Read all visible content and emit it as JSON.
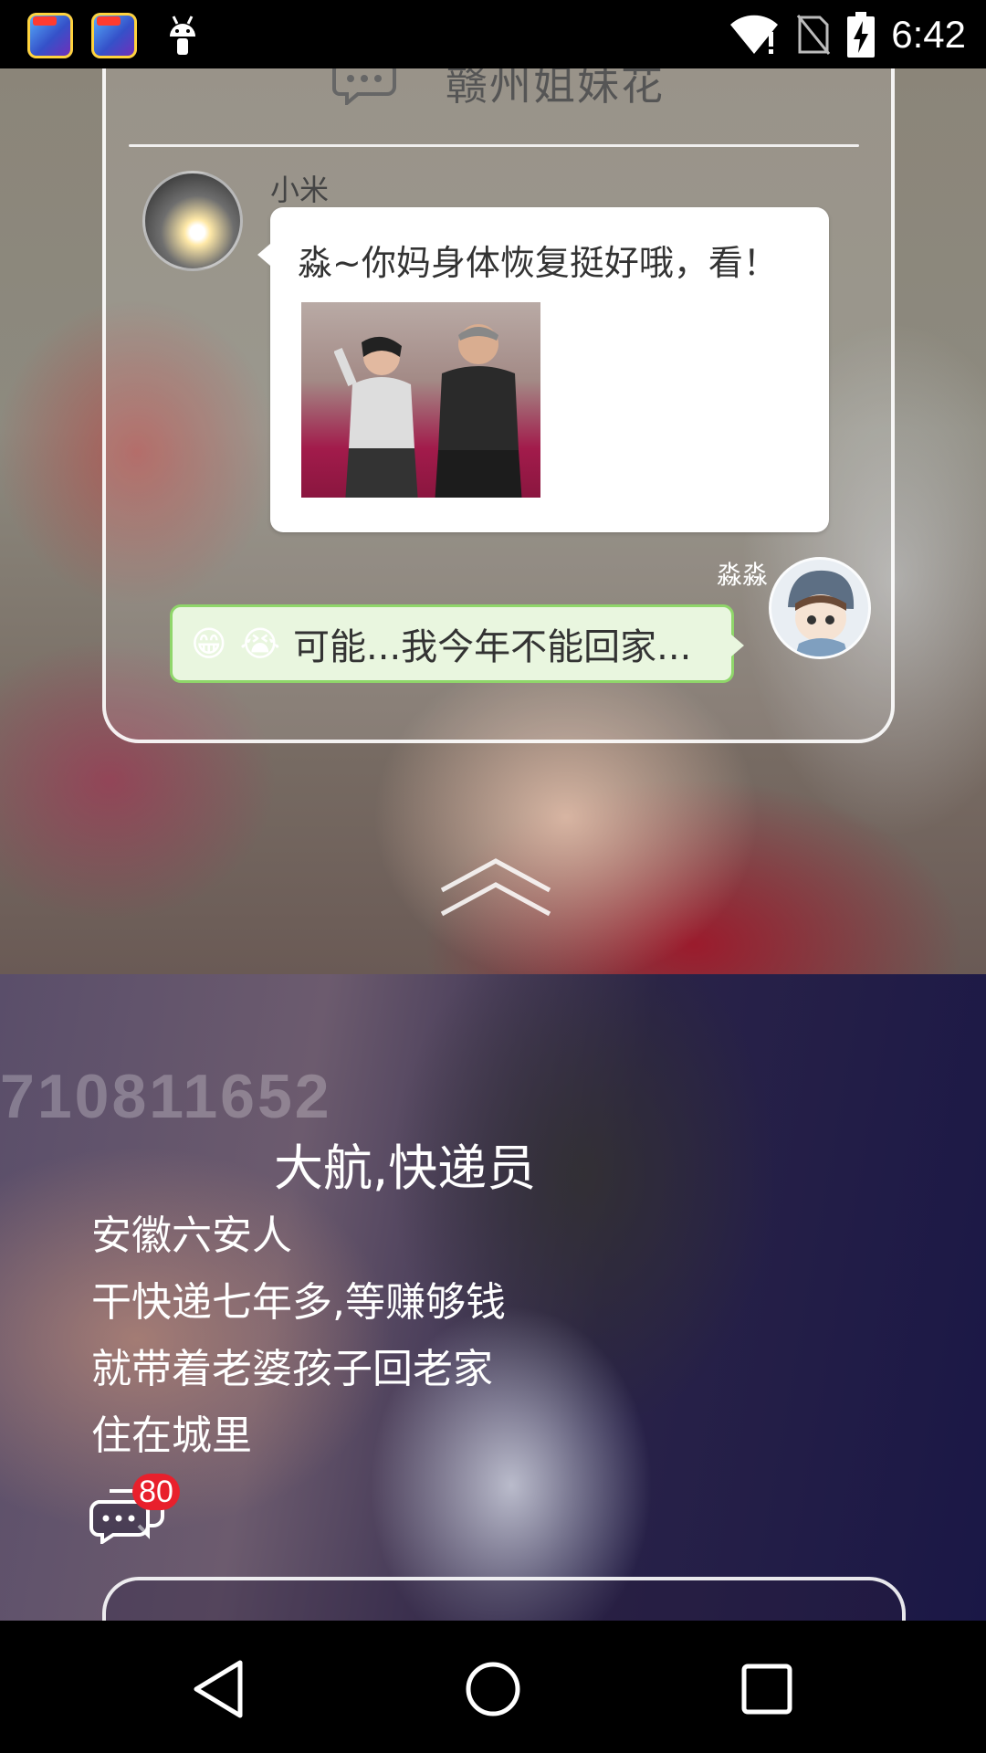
{
  "status_bar": {
    "time": "6:42",
    "icons": [
      "game-app-icon",
      "game-app-icon",
      "android-debug-icon",
      "wifi-alert-icon",
      "no-sim-icon",
      "battery-charging-icon"
    ]
  },
  "chat_card": {
    "title": "赣州姐妹花",
    "message_left": {
      "sender": "小米",
      "text": "淼~你妈身体恢复挺好哦，看！"
    },
    "message_right": {
      "sender": "淼淼",
      "emoji_1": "😁",
      "emoji_2": "😭",
      "text": "可能...我今年不能回家..."
    }
  },
  "story": {
    "title": "大航,快递员",
    "lines": [
      "安徽六安人",
      "干快递七年多,等赚够钱",
      "就带着老婆孩子回老家",
      "住在城里"
    ],
    "comment_count": "80"
  },
  "colors": {
    "bubble_right_bg": "#e9f6df",
    "bubble_right_border": "#8fd66a",
    "badge": "#e8202c"
  }
}
